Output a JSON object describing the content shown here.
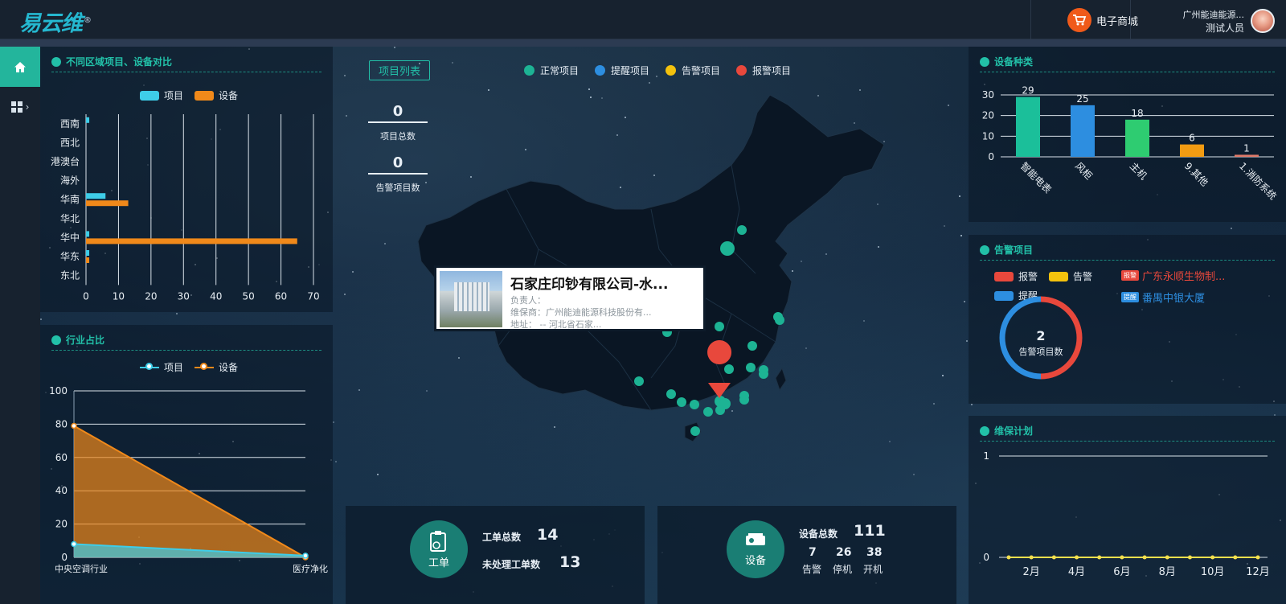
{
  "header": {
    "logo": "易云维",
    "logo_mark": "®",
    "shop_label": "电子商城",
    "company": "广州能迪能源...",
    "user": "测试人员"
  },
  "sidebar": {
    "items": [
      {
        "name": "home",
        "icon": "home-icon"
      },
      {
        "name": "apps",
        "icon": "grid-icon",
        "arrow": "›"
      }
    ]
  },
  "region_panel": {
    "title": "不同区域项目、设备对比",
    "legend": [
      "项目",
      "设备"
    ],
    "chart_data": {
      "type": "bar",
      "orientation": "horizontal",
      "categories": [
        "西南",
        "西北",
        "港澳台",
        "海外",
        "华南",
        "华北",
        "华中",
        "华东",
        "东北"
      ],
      "series": [
        {
          "name": "项目",
          "values": [
            1,
            0,
            0,
            0,
            6,
            0,
            1,
            1,
            0
          ],
          "color": "#3ecde8"
        },
        {
          "name": "设备",
          "values": [
            0,
            0,
            0,
            0,
            13,
            0,
            65,
            1,
            0
          ],
          "color": "#f0891a"
        }
      ],
      "xlim": [
        0,
        70
      ],
      "xticks": [
        "0",
        "10",
        "20",
        "30",
        "40",
        "50",
        "60",
        "70"
      ],
      "grid": true,
      "legend_position": "top"
    }
  },
  "industry_panel": {
    "title": "行业占比",
    "legend": [
      "项目",
      "设备"
    ],
    "chart_data": {
      "type": "area",
      "categories": [
        "中央空调行业",
        "医疗净化"
      ],
      "tick_labels": [
        "中央空调行业",
        "医疗净化"
      ],
      "series": [
        {
          "name": "项目",
          "values": [
            8,
            1
          ],
          "color": "#3ecde8"
        },
        {
          "name": "设备",
          "values": [
            79,
            0
          ],
          "color": "#f0891a"
        }
      ],
      "ylim": [
        0,
        100
      ],
      "yticks": [
        "0",
        "20",
        "40",
        "60",
        "80",
        "100"
      ],
      "grid": true,
      "legend_position": "top"
    }
  },
  "map": {
    "list_button": "项目列表",
    "stats": [
      {
        "value": "0",
        "label": "项目总数",
        "color": "#22c0a8"
      },
      {
        "value": "0",
        "label": "告警项目数",
        "color": "#e8483c"
      }
    ],
    "legend": [
      {
        "label": "正常项目",
        "color": "#1db394"
      },
      {
        "label": "提醒项目",
        "color": "#2d8ee0"
      },
      {
        "label": "告警项目",
        "color": "#f4c20d"
      },
      {
        "label": "报警项目",
        "color": "#e8483c"
      }
    ],
    "popup": {
      "title": "石家庄印钞有限公司-水...",
      "rows": [
        "负责人：",
        "维保商：广州能迪能源科技股份有...",
        "地址：             --  河北省石家..."
      ]
    }
  },
  "workorder": {
    "icon_label": "工单",
    "total_label": "工单总数",
    "total_value": "14",
    "pending_label": "未处理工单数",
    "pending_value": "13"
  },
  "equipment": {
    "icon_label": "设备",
    "total_label": "设备总数",
    "total_value": "111",
    "alarm_value": "7",
    "alarm_label": "告警",
    "stop_value": "26",
    "stop_label": "停机",
    "run_value": "38",
    "run_label": "开机"
  },
  "device_type_panel": {
    "title": "设备种类",
    "chart_data": {
      "type": "bar",
      "categories": [
        "智能电表",
        "风柜",
        "主机",
        "9.其他",
        "1.消防系统"
      ],
      "values": [
        29,
        25,
        18,
        6,
        1
      ],
      "data_labels": [
        "29",
        "25",
        "18",
        "6",
        "1"
      ],
      "colors": [
        "#1bbf9a",
        "#2d8ee0",
        "#2ecc71",
        "#f39c12",
        "#e07a6a"
      ],
      "ylim": [
        0,
        30
      ],
      "yticks": [
        "0",
        "10",
        "20",
        "30"
      ],
      "grid": true
    }
  },
  "alarm_panel": {
    "title": "告警项目",
    "legend": [
      {
        "label": "报警",
        "color": "#e8483c"
      },
      {
        "label": "告警",
        "color": "#f4c20d"
      },
      {
        "label": "提醒",
        "color": "#2d8ee0"
      }
    ],
    "donut_value": "2",
    "donut_label": "告警项目数",
    "donut_segments": [
      {
        "name": "报警",
        "value": 1,
        "color": "#e8483c"
      },
      {
        "name": "提醒",
        "value": 1,
        "color": "#2d8ee0"
      }
    ],
    "items": [
      {
        "tag": "报警",
        "name": "广东永顺生物制...",
        "color": "#e8483c"
      },
      {
        "tag": "提醒",
        "name": "番禺中银大厦",
        "color": "#2d8ee0"
      }
    ]
  },
  "maintenance_panel": {
    "title": "维保计划",
    "chart_data": {
      "type": "line",
      "x": [
        "1月",
        "2月",
        "3月",
        "4月",
        "5月",
        "6月",
        "7月",
        "8月",
        "9月",
        "10月",
        "11月",
        "12月"
      ],
      "xtick_labels": [
        "2月",
        "4月",
        "6月",
        "8月",
        "10月",
        "12月"
      ],
      "values": [
        0,
        0,
        0,
        0,
        0,
        0,
        0,
        0,
        0,
        0,
        0,
        0
      ],
      "color": "#f4e04d",
      "ylim": [
        0,
        1
      ],
      "yticks": [
        "0",
        "1"
      ],
      "grid": true
    }
  }
}
